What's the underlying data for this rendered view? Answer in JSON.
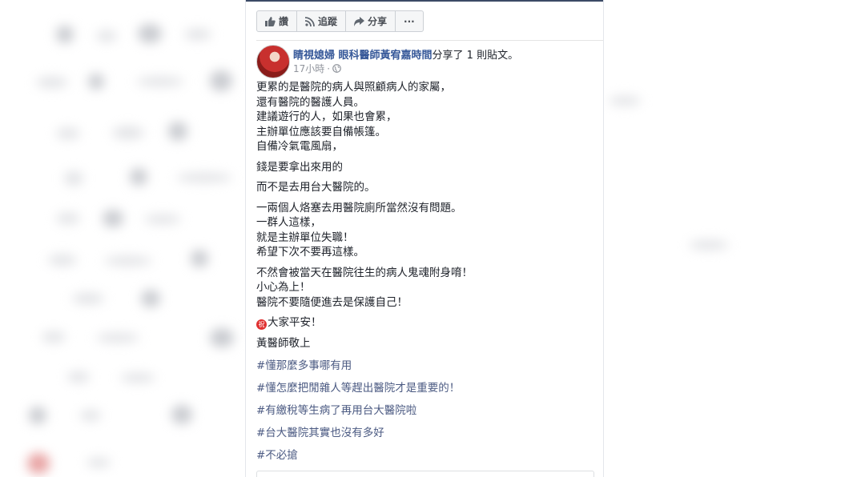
{
  "actions": {
    "like": "讚",
    "follow": "追蹤",
    "share": "分享",
    "more": "···"
  },
  "post": {
    "author": "睛視媳婦 眼科醫師黃宥嘉時間",
    "shared_text": "分享了 1 則貼文。",
    "time": "17小時",
    "dot": "·",
    "paragraphs": [
      [
        "更累的是醫院的病人與照顧病人的家屬，",
        "還有醫院的醫護人員。",
        "建議遊行的人，如果也會累，",
        "主辦單位應該要自備帳篷。",
        "自備冷氣電風扇，"
      ],
      [
        "錢是要拿出來用的"
      ],
      [
        "而不是去用台大醫院的。"
      ],
      [
        "一兩個人烙塞去用醫院廁所當然沒有問題。",
        "一群人這樣，",
        "就是主辦單位失職！",
        "希望下次不要再這樣。"
      ],
      [
        "不然會被當天在醫院往生的病人鬼魂附身唷！",
        "小心為上！",
        "醫院不要隨便進去是保護自己！"
      ]
    ],
    "blessing_emoji": "祝",
    "blessing_text": "大家平安！",
    "signature": "黃醫師敬上",
    "hashtags": [
      "#懂那麼多事哪有用",
      "#懂怎麼把閒雜人等趕出醫院才是重要的！",
      "#有繳稅等生病了再用台大醫院啦",
      "#台大醫院其實也沒有多好",
      "#不必搶"
    ]
  }
}
